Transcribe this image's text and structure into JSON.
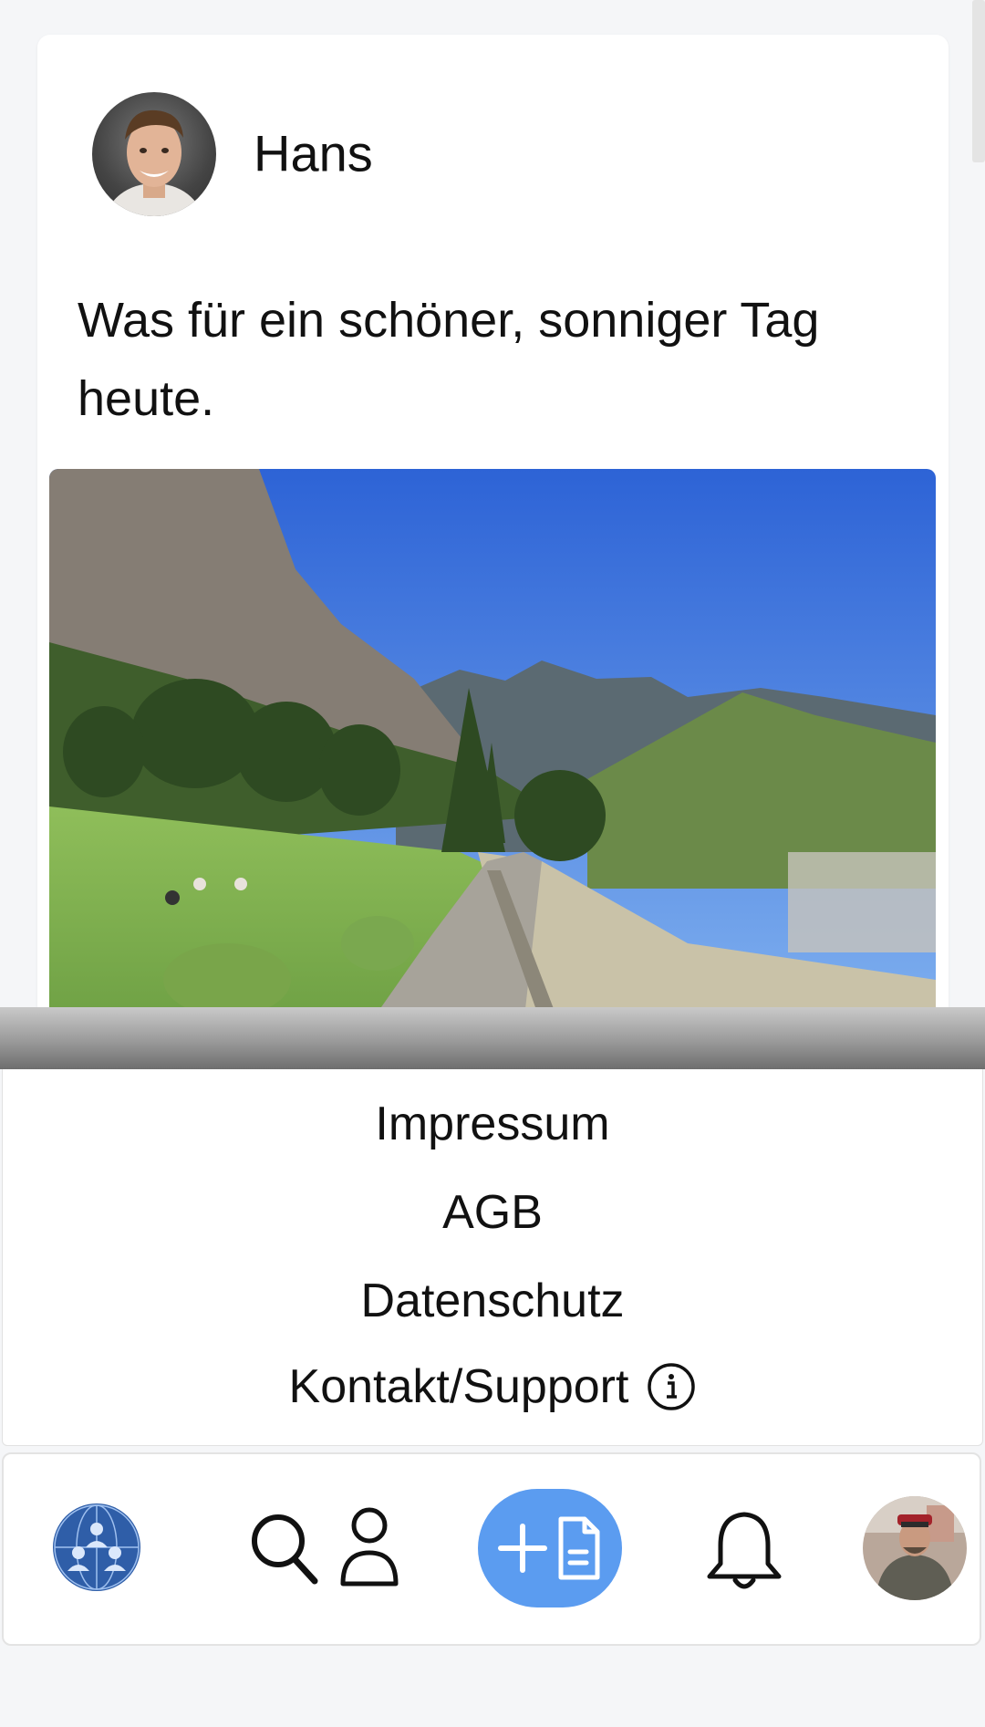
{
  "post": {
    "author": "Hans",
    "text": "Was für ein schöner, sonniger Tag heute."
  },
  "footer": {
    "links": [
      "Impressum",
      "AGB",
      "Datenschutz",
      "Kontakt/Support"
    ]
  },
  "nav": {
    "items": [
      "globe-community-icon",
      "search-icon",
      "user-icon",
      "create-post-icon",
      "bell-icon",
      "profile-avatar"
    ],
    "accent_color": "#5b9cf0"
  }
}
